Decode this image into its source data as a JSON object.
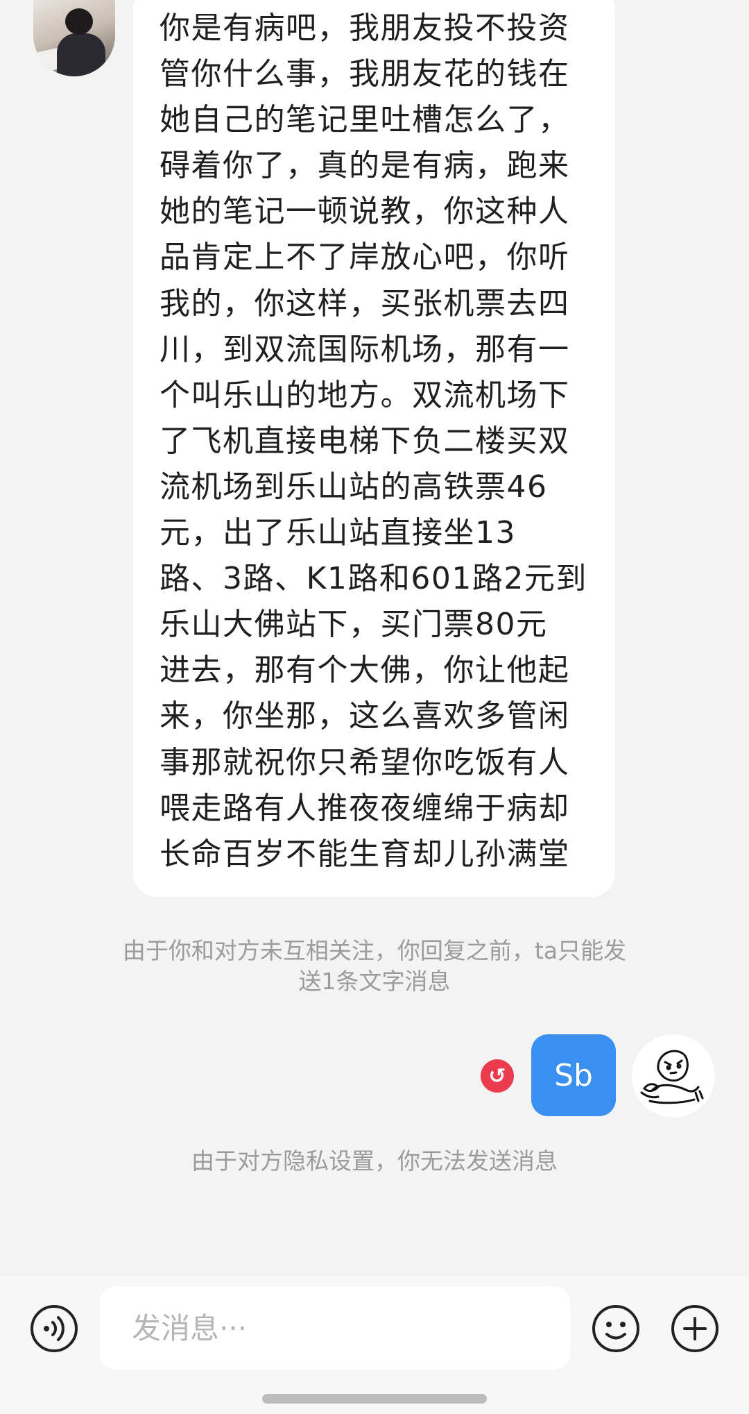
{
  "chat": {
    "incoming_message": "你是有病吧，我朋友投不投资\n管你什么事，我朋友花的钱在\n她自己的笔记里吐槽怎么了，\n碍着你了，真的是有病，跑来\n她的笔记一顿说教，你这种人\n品肯定上不了岸放心吧，你听\n我的，你这样，买张机票去四\n川，到双流国际机场，那有一\n个叫乐山的地方。双流机场下\n了飞机直接电梯下负二楼买双\n流机场到乐山站的高铁票46\n元，出了乐山站直接坐13\n路、3路、K1路和601路2元到\n乐山大佛站下，买门票80元\n进去，那有个大佛，你让他起\n来，你坐那，这么喜欢多管闲\n事那就祝你只希望你吃饭有人\n喂走路有人推夜夜缠绵于病却\n长命百岁不能生育却儿孙满堂",
    "notice_follow": "由于你和对方未互相关注，你回复之前，ta只能发\n送1条文字消息",
    "outgoing_message": "Sb",
    "notice_privacy": "由于对方隐私设置，你无法发送消息"
  },
  "input": {
    "placeholder": "发消息···"
  },
  "icons": {
    "voice": "voice-icon",
    "emoji": "emoji-icon",
    "plus": "plus-icon",
    "retry": "retry-icon"
  },
  "colors": {
    "outgoing_bubble": "#3b8ff0",
    "retry_badge": "#ec3b4f"
  }
}
